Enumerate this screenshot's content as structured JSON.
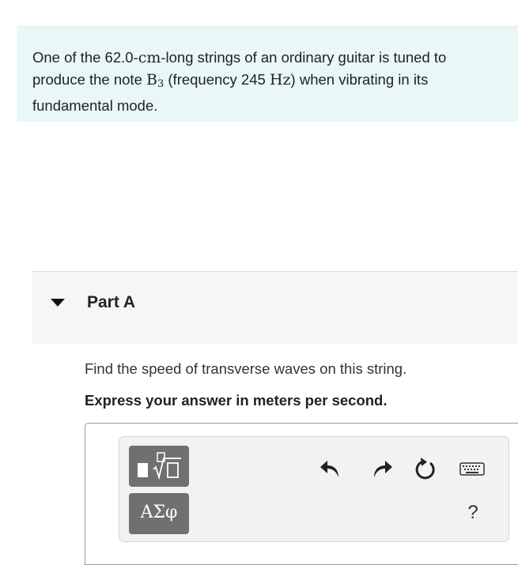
{
  "problem": {
    "text_1": "One of the 62.0-",
    "unit_cm": "cm",
    "text_2": "-long strings of an ordinary guitar is tuned to",
    "text_3": "produce the note ",
    "note_letter": "B",
    "note_octave": "3",
    "text_4": " (frequency 245 ",
    "unit_hz": "Hz",
    "text_5": ") when vibrating in its",
    "text_6": "fundamental mode."
  },
  "part": {
    "title": "Part A",
    "instruction": "Find the speed of transverse waves on this string.",
    "express": "Express your answer in meters per second."
  },
  "toolbar": {
    "symbols_label": "ΑΣφ",
    "help_label": "?",
    "icons": [
      "templates-icon",
      "undo-icon",
      "redo-icon",
      "reset-icon",
      "keyboard-icon",
      "help-icon"
    ]
  }
}
